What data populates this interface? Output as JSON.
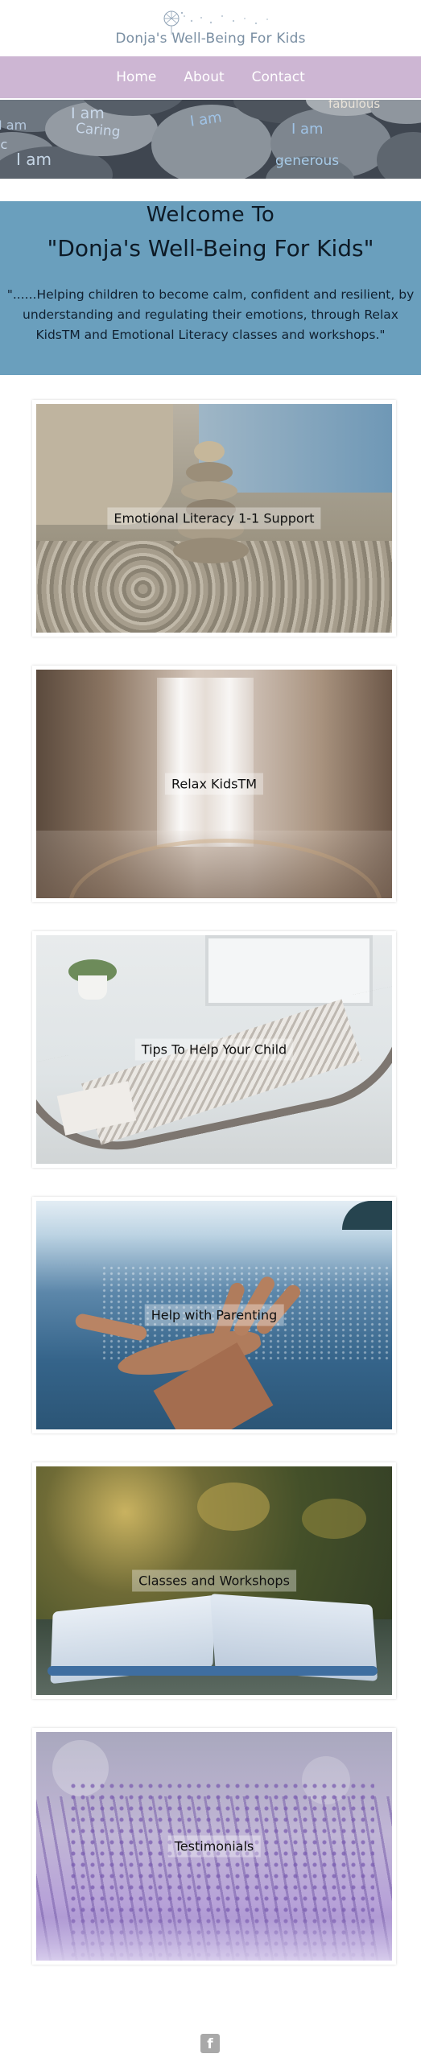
{
  "site": {
    "logo_text": "Donja's Well-Being For Kids"
  },
  "nav": {
    "items": [
      "Home",
      "About",
      "Contact"
    ]
  },
  "banner": {
    "stone_words": [
      "I am",
      "Caring",
      "I am",
      "fabulous",
      "I am",
      "I am",
      "generous",
      "I am",
      "lc"
    ]
  },
  "welcome": {
    "heading": "Welcome To",
    "subheading": "\"Donja's Well-Being For Kids\"",
    "tagline": "\"......Helping children to become calm, confident and resilient, by understanding and regulating their emotions, through Relax KidsTM and Emotional Literacy classes and workshops.\""
  },
  "cards": [
    {
      "label": "Emotional Literacy 1-1 Support"
    },
    {
      "label": "Relax KidsTM"
    },
    {
      "label": "Tips To Help Your Child"
    },
    {
      "label": "Help with Parenting"
    },
    {
      "label": "Classes and Workshops"
    },
    {
      "label": "Testimonials"
    }
  ],
  "footer": {
    "facebook_icon": "f"
  },
  "colors": {
    "nav_bg": "#cdb6d3",
    "welcome_bg": "#6a9fbd",
    "logo_text": "#7a8fa3"
  }
}
